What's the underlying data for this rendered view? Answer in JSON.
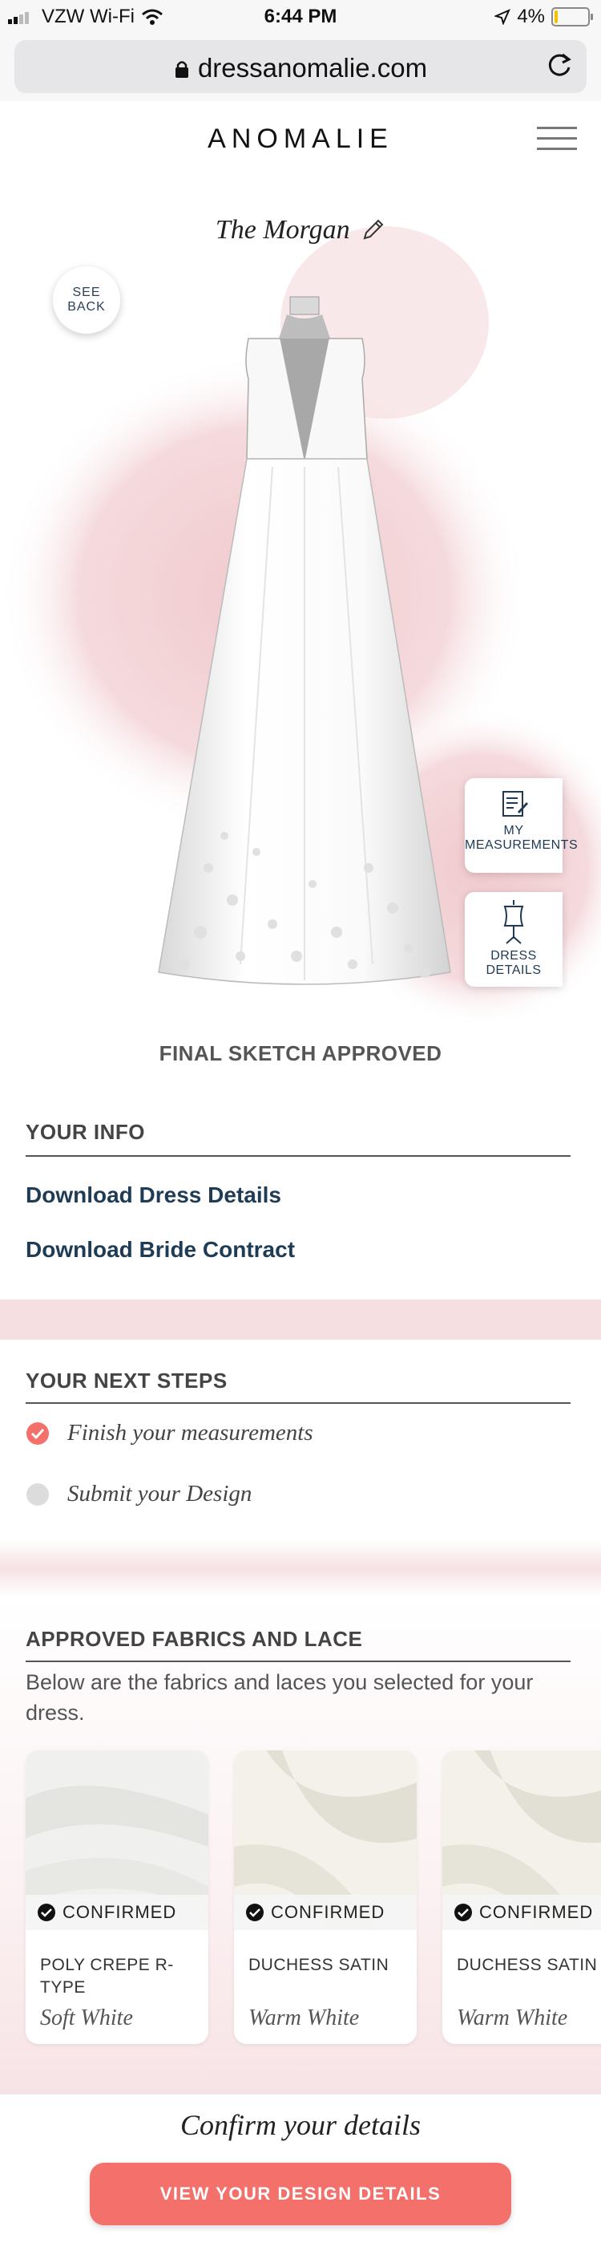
{
  "status_bar": {
    "carrier": "VZW Wi-Fi",
    "time": "6:44 PM",
    "battery": "4%"
  },
  "browser": {
    "url": "dressanomalie.com"
  },
  "header": {
    "logo": "ANOMALIE"
  },
  "hero": {
    "dress_name": "The Morgan",
    "see_back_line1": "SEE",
    "see_back_line2": "BACK",
    "measurements_line1": "MY",
    "measurements_line2": "MEASUREMENTS",
    "dress_details_label": "DRESS DETAILS",
    "status": "FINAL SKETCH APPROVED"
  },
  "your_info": {
    "title": "YOUR INFO",
    "links": [
      "Download Dress Details",
      "Download Bride Contract"
    ]
  },
  "next_steps": {
    "title": "YOUR NEXT STEPS",
    "steps": [
      {
        "label": "Finish your measurements",
        "done": true
      },
      {
        "label": "Submit your Design",
        "done": false
      }
    ]
  },
  "fabrics": {
    "title": "APPROVED FABRICS AND LACE",
    "description": "Below are the fabrics and laces you selected for your dress.",
    "items": [
      {
        "status": "CONFIRMED",
        "name": "POLY CREPE R-TYPE",
        "color": "Soft White"
      },
      {
        "status": "CONFIRMED",
        "name": "DUCHESS SATIN",
        "color": "Warm White"
      },
      {
        "status": "CONFIRMED",
        "name": "DUCHESS SATIN",
        "color": "Warm White"
      }
    ]
  },
  "confirm": {
    "heading": "Confirm your details",
    "button": "VIEW YOUR DESIGN DETAILS"
  },
  "colors": {
    "accent": "#f4706b",
    "link": "#1e3c56",
    "watercolor": "#f2d0d3"
  },
  "icons": [
    "wifi-icon",
    "location-icon",
    "lock-icon",
    "reload-icon",
    "hamburger-icon",
    "pencil-icon",
    "measurements-icon",
    "dress-form-icon",
    "check-circle-icon"
  ]
}
